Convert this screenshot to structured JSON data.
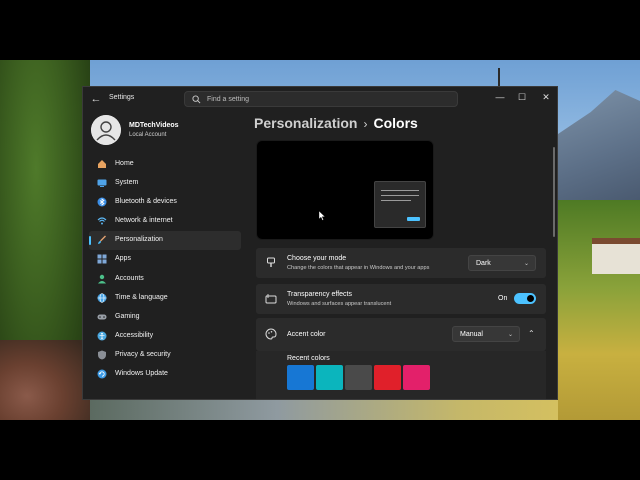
{
  "app": {
    "title": "Settings"
  },
  "search": {
    "placeholder": "Find a setting"
  },
  "window_controls": {
    "minimize": "—",
    "maximize": "☐",
    "close": "✕"
  },
  "profile": {
    "name": "MDTechVideos",
    "account_type": "Local Account"
  },
  "sidebar": {
    "items": [
      {
        "label": "Home",
        "icon": "home-icon",
        "color": "#e8a360",
        "active": false
      },
      {
        "label": "System",
        "icon": "system-icon",
        "color": "#4fa3e8",
        "active": false
      },
      {
        "label": "Bluetooth & devices",
        "icon": "bluetooth-icon",
        "color": "#3a8ee6",
        "active": false
      },
      {
        "label": "Network & internet",
        "icon": "wifi-icon",
        "color": "#5bb4f0",
        "active": false
      },
      {
        "label": "Personalization",
        "icon": "brush-icon",
        "color": "#e0a070",
        "active": true
      },
      {
        "label": "Apps",
        "icon": "apps-icon",
        "color": "#7fa8d8",
        "active": false
      },
      {
        "label": "Accounts",
        "icon": "accounts-icon",
        "color": "#4cc08a",
        "active": false
      },
      {
        "label": "Time & language",
        "icon": "globe-icon",
        "color": "#4aa6e8",
        "active": false
      },
      {
        "label": "Gaming",
        "icon": "gaming-icon",
        "color": "#9aa0a8",
        "active": false
      },
      {
        "label": "Accessibility",
        "icon": "accessibility-icon",
        "color": "#4aa8e0",
        "active": false
      },
      {
        "label": "Privacy & security",
        "icon": "shield-icon",
        "color": "#8a8f96",
        "active": false
      },
      {
        "label": "Windows Update",
        "icon": "update-icon",
        "color": "#3d9be6",
        "active": false
      }
    ]
  },
  "breadcrumb": {
    "parent": "Personalization",
    "separator": "›",
    "current": "Colors"
  },
  "settings": {
    "mode": {
      "title": "Choose your mode",
      "description": "Change the colors that appear in Windows and your apps",
      "value": "Dark"
    },
    "transparency": {
      "title": "Transparency effects",
      "description": "Windows and surfaces appear translucent",
      "state_label": "On",
      "enabled": true
    },
    "accent": {
      "title": "Accent color",
      "value": "Manual",
      "recent_label": "Recent colors",
      "recent_colors": [
        "#1777d4",
        "#0bb5bd",
        "#4a4a4a",
        "#e0202a",
        "#e3206a"
      ]
    }
  },
  "colors": {
    "accent": "#4cc2ff",
    "window_bg": "#202020",
    "card_bg": "#2b2b2b"
  }
}
